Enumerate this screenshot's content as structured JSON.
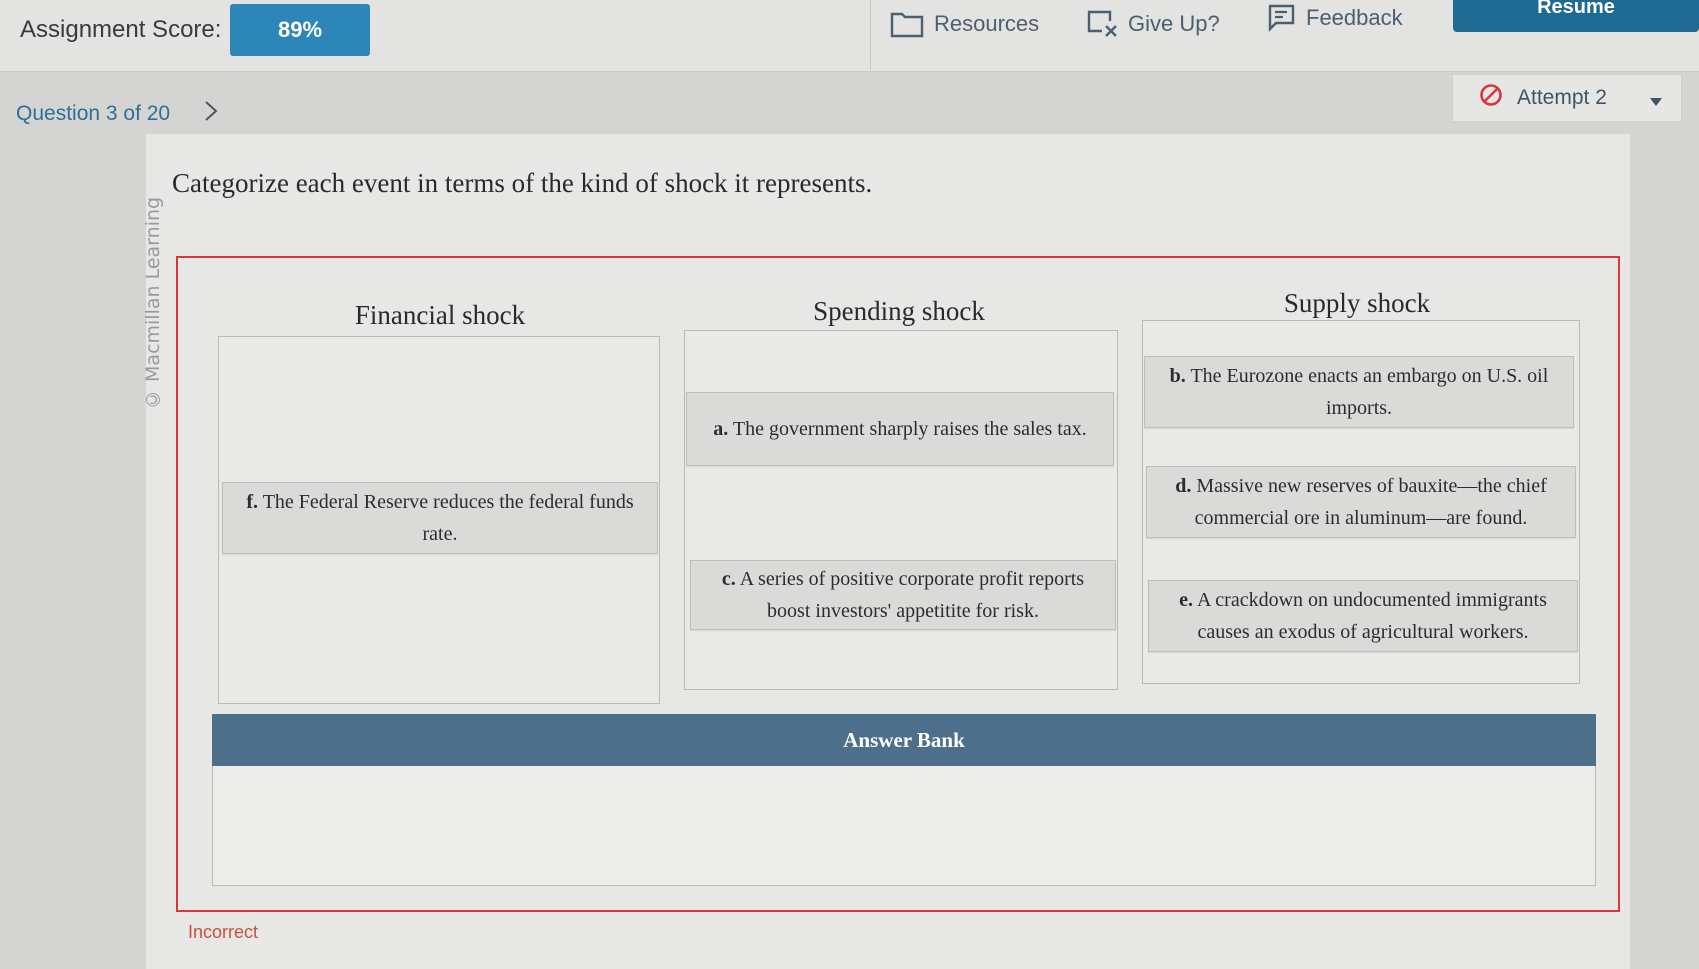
{
  "header": {
    "score_label": "Assignment Score:",
    "score_value": "89%",
    "resources_label": "Resources",
    "give_up_label": "Give Up?",
    "feedback_label": "Feedback",
    "resume_label": "Resume"
  },
  "nav": {
    "question_label": "Question 3 of 20",
    "attempt_label": "Attempt 2"
  },
  "copyright": "© Macmillan Learning",
  "prompt": "Categorize each event in terms of the kind of shock it represents.",
  "columns": [
    {
      "title": "Financial shock",
      "cards": [
        {
          "letter": "f.",
          "text": "The Federal Reserve reduces the federal funds rate."
        }
      ]
    },
    {
      "title": "Spending shock",
      "cards": [
        {
          "letter": "a.",
          "text": "The government sharply raises the sales tax."
        },
        {
          "letter": "c.",
          "text": "A series of positive corporate profit reports boost investors' appetitite for risk."
        }
      ]
    },
    {
      "title": "Supply shock",
      "cards": [
        {
          "letter": "b.",
          "text": "The Eurozone enacts an embargo on U.S. oil imports."
        },
        {
          "letter": "d.",
          "text": "Massive new reserves of bauxite—the chief commercial ore in aluminum—are found."
        },
        {
          "letter": "e.",
          "text": "A crackdown on undocumented immigrants causes an exodus of agricultural workers."
        }
      ]
    }
  ],
  "answer_bank": {
    "title": "Answer Bank"
  },
  "status": "Incorrect",
  "colors": {
    "accent": "#2c86b8",
    "resume": "#1f6a93",
    "error": "#d8383a",
    "bank_header": "#4d6f8c"
  },
  "icons": [
    "folder-icon",
    "give-up-icon",
    "feedback-icon",
    "chevron-right-icon",
    "no-entry-icon",
    "caret-down-icon"
  ]
}
